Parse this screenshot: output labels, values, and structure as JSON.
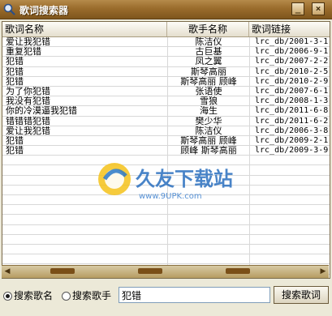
{
  "window": {
    "title": "歌词搜索器",
    "minimize_glyph": "_",
    "close_glyph": "×"
  },
  "table": {
    "columns": [
      "歌词名称",
      "歌手名称",
      "歌词链接"
    ],
    "rows": [
      [
        "爱让我犯错",
        "陈洁仪",
        "lrc_db/2001-3-1..."
      ],
      [
        "重复犯错",
        "古巨基",
        "lrc_db/2006-9-1..."
      ],
      [
        "犯错",
        "凤之翼",
        "lrc_db/2007-2-2..."
      ],
      [
        "犯错",
        "斯琴高丽",
        "lrc_db/2010-2-5..."
      ],
      [
        "犯错",
        "斯琴高丽 顾峰",
        "lrc_db/2010-2-9..."
      ],
      [
        "为了你犯错",
        "张语使",
        "lrc_db/2007-6-1..."
      ],
      [
        "我没有犯错",
        "雪狼",
        "lrc_db/2008-1-3..."
      ],
      [
        "你的冷漠逼我犯错",
        "海生",
        "lrc_db/2011-6-8..."
      ],
      [
        "错错错犯错",
        "樊少华",
        "lrc_db/2011-6-2..."
      ],
      [
        "爱让我犯错",
        "陈洁仪",
        "lrc_db/2006-3-8..."
      ],
      [
        "犯错",
        "斯琴高丽 顾峰",
        "lrc_db/2009-2-1..."
      ],
      [
        "犯错",
        "顾峰 斯琴高丽",
        "lrc_db/2009-3-9..."
      ]
    ]
  },
  "watermark": {
    "brand": "久友下载站",
    "url": "www.9UPK.com"
  },
  "search": {
    "radio_song_label": "搜索歌名",
    "radio_singer_label": "搜索歌手",
    "selected": "song",
    "query": "犯错",
    "button_label": "搜索歌词"
  },
  "colors": {
    "titlebar": "#9a6c2c",
    "scrollbar": "#b79c62",
    "scroll_thumb": "#7a4f18"
  }
}
